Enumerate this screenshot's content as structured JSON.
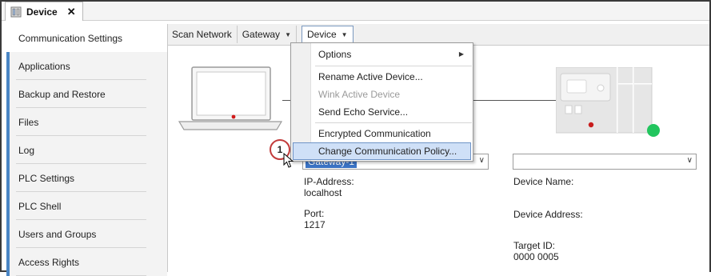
{
  "tab": {
    "title": "Device",
    "close_glyph": "✕",
    "icon": "device-icon"
  },
  "sidebar": {
    "accent": "#4a86c5",
    "items": [
      {
        "label": "Communication Settings",
        "active": true
      },
      {
        "label": "Applications"
      },
      {
        "label": "Backup and Restore"
      },
      {
        "label": "Files"
      },
      {
        "label": "Log"
      },
      {
        "label": "PLC Settings"
      },
      {
        "label": "PLC Shell"
      },
      {
        "label": "Users and Groups"
      },
      {
        "label": "Access Rights"
      }
    ]
  },
  "toolbar": {
    "scan_label": "Scan Network",
    "gateway_label": "Gateway",
    "device_label": "Device"
  },
  "gateway_select": {
    "value": "Gateway-1"
  },
  "device_select": {
    "value": ""
  },
  "gateway_info": {
    "ip_label": "IP-Address:",
    "ip_value": "localhost",
    "port_label": "Port:",
    "port_value": "1217"
  },
  "device_info": {
    "name_label": "Device Name:",
    "address_label": "Device Address:",
    "target_label": "Target ID:",
    "target_value": "0000  0005"
  },
  "device_menu": {
    "options": "Options",
    "rename": "Rename Active Device...",
    "wink": "Wink Active Device",
    "echo": "Send Echo Service...",
    "encrypted": "Encrypted Communication",
    "policy": "Change Communication Policy..."
  },
  "callout": {
    "number": "1"
  },
  "colors": {
    "status_green": "#22c55e",
    "highlight": "#3b73c4",
    "callout_red": "#c23b3b"
  }
}
